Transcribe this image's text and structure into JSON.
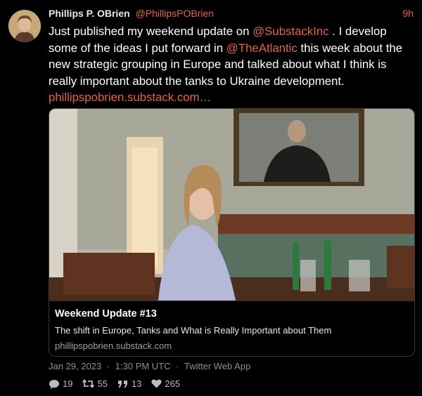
{
  "tweet": {
    "author_name": "Phillips P. OBrien",
    "author_handle": "@PhillipsPOBrien",
    "time_ago": "9h",
    "text_1": "Just published my weekend update on ",
    "mention_1": "@SubstackInc",
    "text_2": " . I develop some of the ideas I put forward in ",
    "mention_2": "@TheAtlantic",
    "text_3": " this week about the new strategic grouping in Europe and talked about what I think is really important about the tanks to Ukraine development. ",
    "link": "phillipspobrien.substack.com…",
    "date": "Jan 29, 2023",
    "time": "1:30 PM UTC",
    "client": "Twitter Web App",
    "separator": "·"
  },
  "card": {
    "title": "Weekend Update #13",
    "description": "The shift in Europe, Tanks and What is Really Important about Them",
    "domain": "phillipspobrien.substack.com"
  },
  "stats": {
    "replies": "19",
    "retweets": "55",
    "quotes": "13",
    "likes": "265"
  },
  "icons": {
    "reply": "speech-bubble-icon",
    "retweet": "retweet-icon",
    "quote": "quote-icon",
    "like": "heart-icon"
  }
}
